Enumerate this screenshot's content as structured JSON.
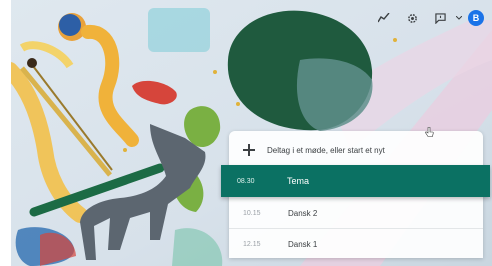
{
  "toolbar": {
    "icons": [
      "activity-icon",
      "gear-icon",
      "feedback-icon",
      "chevron-down-icon"
    ],
    "avatar_letter": "B",
    "avatar_color": "#1a73e8"
  },
  "agenda": {
    "start_label": "Deltag i et møde, eller start et nyt",
    "items": [
      {
        "time": "08.30",
        "title": "Tema",
        "active": true
      },
      {
        "time": "10.15",
        "title": "Dansk 2",
        "active": false
      },
      {
        "time": "12.15",
        "title": "Dansk 1",
        "active": false
      }
    ]
  },
  "colors": {
    "accent": "#0b7163"
  }
}
